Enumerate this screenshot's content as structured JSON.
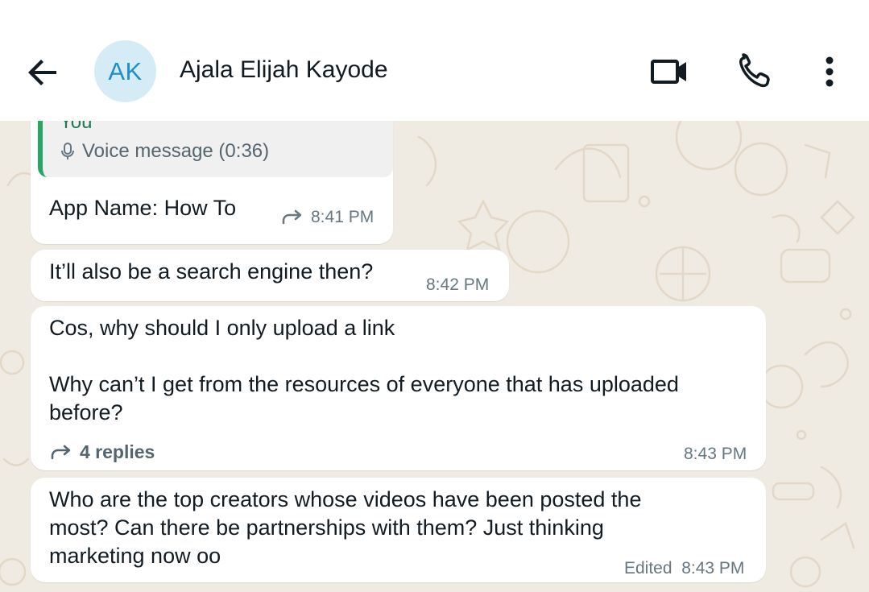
{
  "header": {
    "avatar_initials": "AK",
    "contact_name": "Ajala Elijah Kayode"
  },
  "messages": [
    {
      "quote_author": "You",
      "quote_text": "Voice message (0:36)",
      "text": "App Name: How To",
      "time": "8:41 PM",
      "forwarded": true
    },
    {
      "text": "It’ll also be a search engine then?",
      "time": "8:42 PM"
    },
    {
      "text": "Cos, why should I only upload a link\n\nWhy can’t I get from the resources of everyone that has uploaded\nbefore?",
      "replies": "4 replies",
      "time": "8:43 PM"
    },
    {
      "text": "Who are the top creators whose videos have been posted the\nmost? Can there be partnerships with them? Just thinking\nmarketing now oo",
      "edited": "Edited",
      "time": "8:43 PM"
    }
  ],
  "colors": {
    "chat_background": "#efeae2",
    "quote_bar": "#25a864",
    "avatar_bg": "#d5ecf7",
    "avatar_text": "#1e8fc9"
  }
}
